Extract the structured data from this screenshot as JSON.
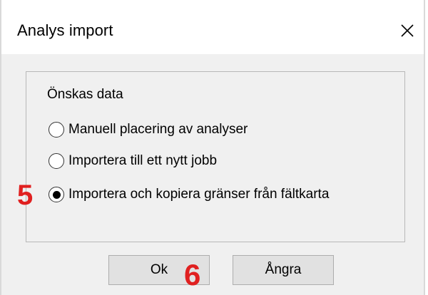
{
  "window": {
    "title": "Analys import",
    "close_icon": "close-icon"
  },
  "group": {
    "label": "Önskas data"
  },
  "options": [
    {
      "label": "Manuell placering av analyser",
      "selected": false
    },
    {
      "label": "Importera till ett nytt jobb",
      "selected": false
    },
    {
      "label": "Importera och kopiera gränser från fältkarta",
      "selected": true
    }
  ],
  "buttons": {
    "ok_label": "Ok",
    "cancel_label": "Ångra"
  },
  "annotations": {
    "option_marker": "5",
    "button_marker": "6"
  },
  "colors": {
    "annotation": "#e02020",
    "dialog_bg": "#f0f0f0",
    "button_bg": "#e1e1e1"
  }
}
